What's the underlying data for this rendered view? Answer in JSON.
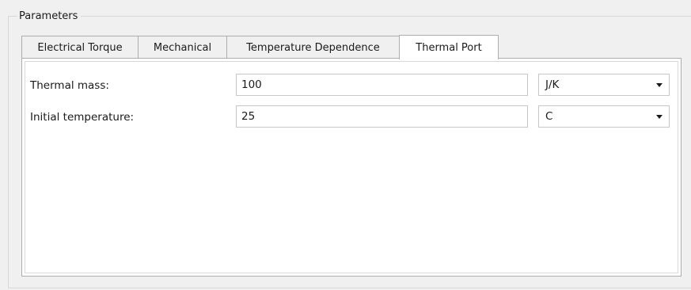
{
  "group": {
    "title": "Parameters"
  },
  "tabs": [
    {
      "label": "Electrical Torque",
      "active": false
    },
    {
      "label": "Mechanical",
      "active": false
    },
    {
      "label": "Temperature Dependence",
      "active": false
    },
    {
      "label": "Thermal Port",
      "active": true
    }
  ],
  "thermal_port": {
    "rows": [
      {
        "label": "Thermal mass:",
        "value": "100",
        "unit": "J/K"
      },
      {
        "label": "Initial temperature:",
        "value": "25",
        "unit": "C"
      }
    ]
  },
  "icons": {
    "dropdown": "chevron-down-icon"
  }
}
